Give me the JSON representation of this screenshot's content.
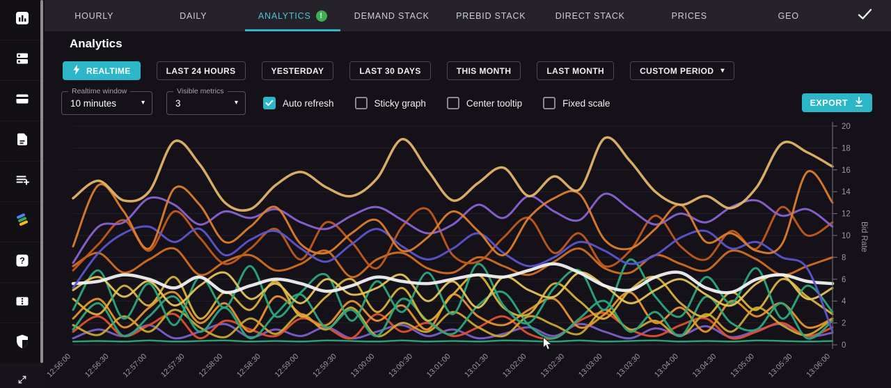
{
  "nav": {
    "tabs": [
      {
        "label": "HOURLY",
        "active": false
      },
      {
        "label": "DAILY",
        "active": false
      },
      {
        "label": "ANALYTICS",
        "active": true,
        "badge": "!"
      },
      {
        "label": "DEMAND STACK",
        "active": false
      },
      {
        "label": "PREBID STACK",
        "active": false
      },
      {
        "label": "DIRECT STACK",
        "active": false
      },
      {
        "label": "PRICES",
        "active": false
      },
      {
        "label": "GEO",
        "active": false
      }
    ],
    "check_icon": "check-icon"
  },
  "sidebar": {
    "items": [
      {
        "icon": "bar-chart-icon"
      },
      {
        "icon": "dns-list-icon"
      },
      {
        "icon": "credit-card-icon"
      },
      {
        "icon": "document-icon"
      },
      {
        "icon": "playlist-add-icon"
      },
      {
        "icon": "brand-logo-icon"
      },
      {
        "icon": "help-icon"
      },
      {
        "icon": "ticket-icon"
      },
      {
        "icon": "shield-icon"
      }
    ],
    "bottom_icon": "expand-icon"
  },
  "page": {
    "title": "Analytics"
  },
  "filters": {
    "period_buttons": [
      {
        "label": "REALTIME",
        "active": true,
        "icon": "lightning-icon"
      },
      {
        "label": "LAST 24 HOURS",
        "active": false
      },
      {
        "label": "YESTERDAY",
        "active": false
      },
      {
        "label": "LAST 30 DAYS",
        "active": false
      },
      {
        "label": "THIS MONTH",
        "active": false
      },
      {
        "label": "LAST MONTH",
        "active": false
      },
      {
        "label": "CUSTOM PERIOD",
        "active": false,
        "caret": true
      }
    ],
    "selects": [
      {
        "label": "Realtime window",
        "value": "10 minutes"
      },
      {
        "label": "Visible metrics",
        "value": "3"
      }
    ],
    "checkboxes": [
      {
        "label": "Auto refresh",
        "checked": true
      },
      {
        "label": "Sticky graph",
        "checked": false
      },
      {
        "label": "Center tooltip",
        "checked": false
      },
      {
        "label": "Fixed scale",
        "checked": false
      }
    ],
    "export_label": "EXPORT"
  },
  "colors": {
    "accent": "#2bb7c8",
    "tab_active": "#4cc3d5",
    "badge_green": "#3faf54",
    "grid": "#232027",
    "axis": "#6a6670",
    "axis_text": "#9b98a2"
  },
  "chart_data": {
    "type": "line",
    "title": "",
    "xlabel": "",
    "ylabel": "Bid Rate",
    "ylim": [
      0,
      20
    ],
    "y_ticks": [
      0,
      2,
      4,
      6,
      8,
      10,
      12,
      14,
      16,
      18,
      20
    ],
    "legend": "none",
    "grid": "horizontal",
    "x_labels": [
      "12:56:00",
      "12:56:30",
      "12:57:00",
      "12:57:30",
      "12:58:00",
      "12:58:30",
      "12:59:00",
      "12:59:30",
      "13:00:00",
      "13:00:30",
      "13:01:00",
      "13:01:30",
      "13:02:00",
      "13:02:30",
      "13:03:00",
      "13:03:30",
      "13:04:00",
      "13:04:30",
      "13:05:00",
      "13:05:30",
      "13:06:00"
    ],
    "series": [
      {
        "name": "green-flat",
        "color": "#2aa97c",
        "width": 2.5,
        "values": [
          0.3,
          0.35,
          0.3,
          0.4,
          0.3,
          0.35,
          0.4,
          0.3,
          0.35,
          0.3,
          0.4,
          0.35,
          0.3,
          0.4,
          0.3,
          0.35,
          0.3,
          0.4,
          0.35,
          0.3,
          0.4,
          0.3,
          0.35,
          0.4,
          0.3,
          0.35,
          0.3,
          0.4,
          0.35,
          0.3,
          0.35
        ]
      },
      {
        "name": "purple-low",
        "color": "#7c5fc9",
        "width": 3,
        "values": [
          0.6,
          1.4,
          0.8,
          1.8,
          0.6,
          1.2,
          1.9,
          0.7,
          1.4,
          0.8,
          1.6,
          0.6,
          1.2,
          1.8,
          0.8,
          1.4,
          0.6,
          1.0,
          1.6,
          0.8,
          1.9,
          1.2,
          0.6,
          1.5,
          0.9,
          1.7,
          0.7,
          1.3,
          1.9,
          0.8,
          1.1
        ]
      },
      {
        "name": "red",
        "color": "#e0502f",
        "width": 3,
        "values": [
          1.2,
          2.6,
          0.8,
          1.8,
          2.8,
          0.6,
          2.2,
          1.4,
          0.8,
          2.4,
          1.6,
          0.6,
          2.8,
          1.2,
          2.0,
          0.8,
          1.6,
          2.6,
          1.0,
          0.6,
          2.2,
          2.9,
          1.4,
          0.8,
          1.8,
          2.4,
          0.6,
          1.2,
          2.0,
          0.8,
          1.6
        ]
      },
      {
        "name": "yellow-low",
        "color": "#c9a832",
        "width": 3,
        "values": [
          1.8,
          0.9,
          2.6,
          1.2,
          3.2,
          1.6,
          0.7,
          2.4,
          1.0,
          2.8,
          1.4,
          3.4,
          0.8,
          2.0,
          1.2,
          3.0,
          1.6,
          0.8,
          2.6,
          1.8,
          1.0,
          3.2,
          1.4,
          2.2,
          0.8,
          2.8,
          1.2,
          3.4,
          1.8,
          0.9,
          2.4
        ]
      },
      {
        "name": "orange-low",
        "color": "#e8942e",
        "width": 3,
        "values": [
          2.4,
          4.2,
          1.6,
          3.4,
          4.8,
          2.0,
          3.8,
          1.2,
          4.4,
          2.8,
          1.8,
          4.0,
          2.2,
          3.6,
          1.4,
          4.6,
          2.6,
          1.8,
          3.2,
          4.2,
          1.6,
          2.8,
          4.8,
          2.0,
          3.4,
          1.2,
          4.0,
          2.6,
          3.8,
          1.6,
          2.4
        ]
      },
      {
        "name": "teal-low",
        "color": "#2aa97c",
        "width": 3,
        "values": [
          1.4,
          3.8,
          0.8,
          2.6,
          4.4,
          1.2,
          3.4,
          0.6,
          2.8,
          4.6,
          1.6,
          3.2,
          0.8,
          4.2,
          2.2,
          1.0,
          3.6,
          4.8,
          1.8,
          0.6,
          2.4,
          4.0,
          1.2,
          3.0,
          0.8,
          4.4,
          2.0,
          1.4,
          3.8,
          0.6,
          2.2
        ]
      },
      {
        "name": "yellow-mid",
        "color": "#d9b23a",
        "width": 3,
        "values": [
          4.2,
          2.8,
          5.4,
          3.6,
          6.2,
          2.4,
          4.8,
          3.2,
          5.8,
          2.6,
          4.4,
          6.0,
          3.0,
          5.2,
          2.2,
          4.6,
          6.4,
          3.4,
          2.8,
          5.6,
          4.0,
          2.4,
          5.0,
          6.2,
          3.8,
          2.6,
          4.8,
          3.2,
          6.0,
          4.4,
          2.8
        ]
      },
      {
        "name": "orange-mid",
        "color": "#d2701e",
        "width": 3,
        "values": [
          7.2,
          8.4,
          6.6,
          7.8,
          8.8,
          6.4,
          7.6,
          8.2,
          6.8,
          7.4,
          8.6,
          6.2,
          7.8,
          8.4,
          7.0,
          6.6,
          8.0,
          7.2,
          6.4,
          7.6,
          8.8,
          7.0,
          6.6,
          8.2,
          7.4,
          6.8,
          8.6,
          7.8,
          6.4,
          7.2,
          8.0
        ]
      },
      {
        "name": "teal-main",
        "color": "#2aa97c",
        "width": 3,
        "values": [
          3.2,
          6.8,
          2.4,
          5.6,
          1.8,
          6.2,
          3.4,
          7.2,
          2.6,
          4.8,
          6.4,
          2.2,
          5.8,
          3.0,
          6.6,
          2.8,
          7.4,
          3.6,
          2.0,
          5.2,
          6.8,
          3.2,
          7.8,
          4.4,
          2.6,
          6.2,
          3.8,
          7.0,
          2.4,
          5.4,
          3.0
        ]
      },
      {
        "name": "gold-mid",
        "color": "#e6c455",
        "width": 3,
        "values": [
          5.0,
          6.2,
          4.4,
          5.8,
          3.6,
          5.4,
          6.6,
          4.2,
          5.6,
          3.8,
          6.0,
          4.6,
          5.2,
          6.4,
          4.0,
          5.8,
          3.4,
          6.2,
          5.0,
          4.4,
          6.6,
          5.4,
          3.8,
          5.0,
          6.0,
          4.6,
          3.6,
          5.6,
          6.4,
          4.2,
          5.2
        ]
      },
      {
        "name": "white",
        "color": "#f2f2f2",
        "width": 4.5,
        "values": [
          5.6,
          5.8,
          6.4,
          6.0,
          5.2,
          6.2,
          4.8,
          5.4,
          6.0,
          5.6,
          4.9,
          5.4,
          6.2,
          5.8,
          5.6,
          6.0,
          6.4,
          6.2,
          6.8,
          7.4,
          6.6,
          5.4,
          5.0,
          6.2,
          6.6,
          5.2,
          4.8,
          6.0,
          6.4,
          5.8,
          5.6
        ]
      },
      {
        "name": "burnt-orange",
        "color": "#c05a1d",
        "width": 3,
        "values": [
          6.8,
          9.2,
          11.4,
          8.6,
          12.2,
          9.8,
          7.4,
          8.8,
          10.6,
          7.8,
          11.2,
          9.4,
          7.0,
          10.8,
          12.4,
          8.2,
          7.6,
          9.8,
          11.6,
          8.4,
          10.2,
          7.2,
          8.6,
          11.8,
          9.0,
          7.8,
          10.4,
          8.8,
          12.6,
          10.0,
          11.2
        ]
      },
      {
        "name": "blue-purple",
        "color": "#5b55d0",
        "width": 3,
        "values": [
          5.2,
          8.4,
          10.2,
          10.8,
          9.4,
          10.6,
          8.2,
          9.6,
          10.4,
          8.8,
          7.6,
          9.2,
          10.6,
          9.0,
          7.8,
          8.8,
          10.2,
          8.4,
          7.2,
          8.0,
          9.4,
          8.6,
          7.4,
          8.2,
          9.8,
          10.4,
          8.8,
          9.4,
          8.0,
          7.0,
          1.2
        ]
      },
      {
        "name": "purple",
        "color": "#8a63d2",
        "width": 3,
        "values": [
          7.5,
          10.8,
          11.2,
          13.4,
          12.8,
          11.0,
          12.2,
          11.6,
          12.4,
          11.2,
          10.6,
          11.8,
          12.6,
          11.4,
          10.2,
          11.0,
          12.8,
          11.6,
          13.6,
          12.2,
          11.4,
          13.8,
          12.4,
          11.0,
          12.0,
          11.2,
          12.6,
          13.2,
          11.8,
          12.4,
          10.8
        ]
      },
      {
        "name": "orange-main",
        "color": "#dd7e2c",
        "width": 3,
        "values": [
          9.0,
          14.6,
          12.2,
          8.8,
          14.3,
          12.8,
          9.4,
          10.8,
          12.6,
          9.2,
          8.4,
          10.2,
          11.4,
          8.6,
          9.8,
          12.2,
          10.4,
          8.2,
          11.6,
          13.4,
          13.8,
          9.6,
          8.8,
          10.6,
          12.8,
          9.4,
          10.2,
          8.6,
          9.2,
          15.8,
          13.0
        ]
      },
      {
        "name": "gold-top",
        "color": "#e3b567",
        "width": 3.5,
        "values": [
          13.4,
          15.0,
          13.2,
          14.0,
          18.6,
          16.5,
          13.0,
          12.4,
          14.6,
          15.8,
          14.4,
          13.6,
          15.2,
          18.8,
          16.0,
          13.2,
          14.8,
          16.2,
          13.6,
          15.4,
          14.2,
          18.9,
          16.8,
          14.0,
          12.8,
          13.6,
          12.5,
          14.4,
          18.4,
          17.6,
          16.3
        ]
      }
    ]
  }
}
